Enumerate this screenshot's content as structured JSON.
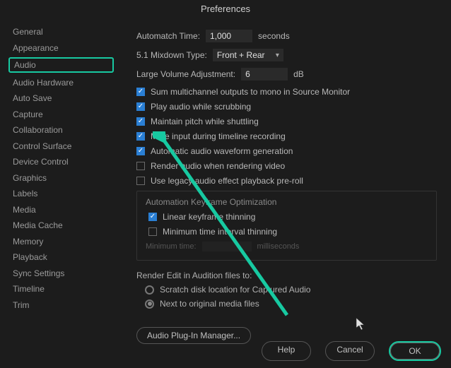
{
  "title": "Preferences",
  "sidebar": {
    "items": [
      {
        "label": "General"
      },
      {
        "label": "Appearance"
      },
      {
        "label": "Audio"
      },
      {
        "label": "Audio Hardware"
      },
      {
        "label": "Auto Save"
      },
      {
        "label": "Capture"
      },
      {
        "label": "Collaboration"
      },
      {
        "label": "Control Surface"
      },
      {
        "label": "Device Control"
      },
      {
        "label": "Graphics"
      },
      {
        "label": "Labels"
      },
      {
        "label": "Media"
      },
      {
        "label": "Media Cache"
      },
      {
        "label": "Memory"
      },
      {
        "label": "Playback"
      },
      {
        "label": "Sync Settings"
      },
      {
        "label": "Timeline"
      },
      {
        "label": "Trim"
      }
    ],
    "active_index": 2
  },
  "automatch": {
    "label": "Automatch Time:",
    "value": "1,000",
    "unit": "seconds"
  },
  "mixdown": {
    "label": "5.1 Mixdown Type:",
    "value": "Front + Rear"
  },
  "lva": {
    "label": "Large Volume Adjustment:",
    "value": "6",
    "unit": "dB"
  },
  "checks": {
    "sum_multi": "Sum multichannel outputs to mono in Source Monitor",
    "play_scrub": "Play audio while scrubbing",
    "maintain_pitch": "Maintain pitch while shuttling",
    "mute_input": "Mute input during timeline recording",
    "auto_waveform": "Automatic audio waveform generation",
    "render_audio": "Render audio when rendering video",
    "legacy_preroll": "Use legacy audio effect playback pre-roll"
  },
  "automation_group": {
    "title": "Automation Keyframe Optimization",
    "linear": "Linear keyframe thinning",
    "min_interval": "Minimum time interval thinning",
    "min_time_label": "Minimum time:",
    "min_time_unit": "milliseconds"
  },
  "render_edit": {
    "title": "Render Edit in Audition files to:",
    "scratch": "Scratch disk location for Captured Audio",
    "next_to": "Next to original media files"
  },
  "plugin_btn": "Audio Plug-In Manager...",
  "footer": {
    "help": "Help",
    "cancel": "Cancel",
    "ok": "OK"
  }
}
